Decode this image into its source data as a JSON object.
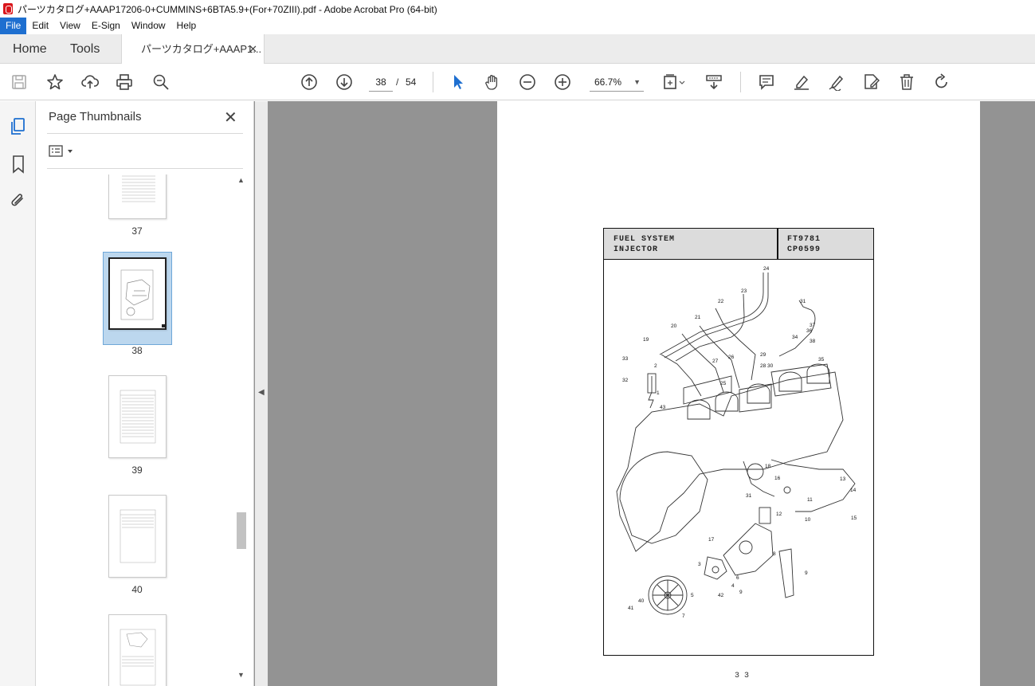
{
  "window": {
    "title": "パーツカタログ+AAAP17206-0+CUMMINS+6BTA5.9+(For+70ZIII).pdf - Adobe Acrobat Pro (64-bit)"
  },
  "menu": [
    "File",
    "Edit",
    "View",
    "E-Sign",
    "Window",
    "Help"
  ],
  "tabs": {
    "home": "Home",
    "tools": "Tools",
    "document": "パーツカタログ+AAAP1..."
  },
  "toolbar": {
    "current_page": "38",
    "page_separator": "/",
    "total_pages": "54",
    "zoom": "66.7%"
  },
  "panel": {
    "title": "Page Thumbnails",
    "thumbnails": [
      {
        "label": "37"
      },
      {
        "label": "38",
        "selected": true
      },
      {
        "label": "39"
      },
      {
        "label": "40"
      },
      {
        "label": ""
      }
    ]
  },
  "document": {
    "header_left_line1": "FUEL SYSTEM",
    "header_left_line2": "INJECTOR",
    "header_right_line1": "FT9781",
    "header_right_line2": "CP0599",
    "page_number": "3 3",
    "callouts": [
      "24",
      "23",
      "31",
      "22",
      "21",
      "37",
      "36",
      "20",
      "19",
      "34",
      "38",
      "26",
      "33",
      "27",
      "29",
      "2",
      "30",
      "28",
      "35",
      "32",
      "25",
      "1",
      "43",
      "14",
      "18",
      "13",
      "16",
      "11",
      "31",
      "15",
      "12",
      "10",
      "17",
      "8",
      "3",
      "6",
      "4",
      "9",
      "5",
      "40",
      "42",
      "41",
      "7",
      "9"
    ]
  },
  "colors": {
    "accent": "#1e6fd0",
    "selection": "#bcd7ee",
    "doc_background": "#939393"
  }
}
